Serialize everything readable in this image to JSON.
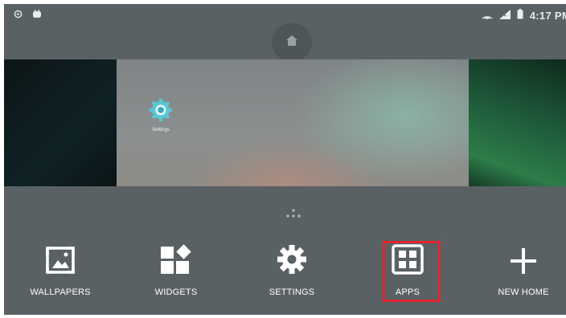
{
  "status_bar": {
    "left_icons": [
      "sync-icon",
      "android-icon"
    ],
    "right_icons": [
      "cast-icon",
      "cell-signal-icon",
      "battery-icon"
    ],
    "time": "4:17 PM"
  },
  "home_indicator": {
    "icon": "home-icon"
  },
  "workspace": {
    "shortcut": {
      "label": "Settings",
      "icon": "settings-app-icon"
    }
  },
  "options": [
    {
      "label": "WALLPAPERS",
      "icon": "wallpaper-icon"
    },
    {
      "label": "WIDGETS",
      "icon": "widgets-icon"
    },
    {
      "label": "SETTINGS",
      "icon": "gear-icon"
    },
    {
      "label": "APPS",
      "icon": "apps-grid-icon",
      "highlighted": true
    },
    {
      "label": "NEW HOME",
      "icon": "plus-icon"
    }
  ],
  "colors": {
    "background": "#5a6165",
    "highlight_box": "#e0262e",
    "text": "#ffffff"
  }
}
